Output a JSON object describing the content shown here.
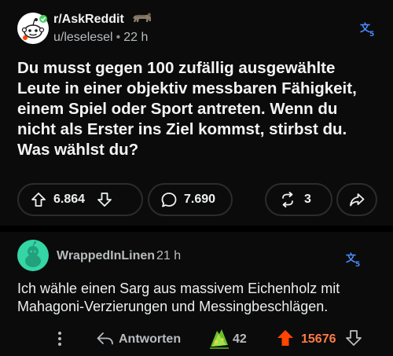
{
  "post": {
    "subreddit": "r/AskReddit",
    "author": "u/leselesel",
    "separator": "•",
    "age": "22 h",
    "title": "Du musst gegen 100 zufällig ausgewählte Leute in einer objektiv messbaren Fähigkeit, einem Spiel oder Sport antreten. Wenn du nicht als Erster ins Ziel kommst, stirbst du. Was wählst du?",
    "upvotes": "6.864",
    "comments": "7.690",
    "shares": "3"
  },
  "comment": {
    "author": "WrappedInLinen",
    "age": "21 h",
    "body": "Ich wähle einen Sarg aus massivem Eichenholz mit Mahagoni-Verzierungen und Messingbeschlägen.",
    "reply_label": "Antworten",
    "award_count": "42",
    "score": "15676"
  },
  "colors": {
    "background": "#000000",
    "card": "#0b0b0b",
    "upvote_active": "#ff4500",
    "score_active": "#ff7a45",
    "translate_icon": "#4a8cff",
    "muted_text": "#b8bcbf"
  },
  "icons": {
    "subreddit_avatar": "reddit-snoo-icon",
    "subreddit_badge": "animal-badge-icon",
    "translate": "translate-icon",
    "upvote": "arrow-up-icon",
    "downvote": "arrow-down-icon",
    "comments": "speech-bubble-icon",
    "crosspost": "crosspost-icon",
    "share": "share-arrow-icon",
    "more": "more-vertical-icon",
    "reply": "reply-icon",
    "award": "award-icon",
    "comment_avatar": "user-avatar-icon"
  }
}
